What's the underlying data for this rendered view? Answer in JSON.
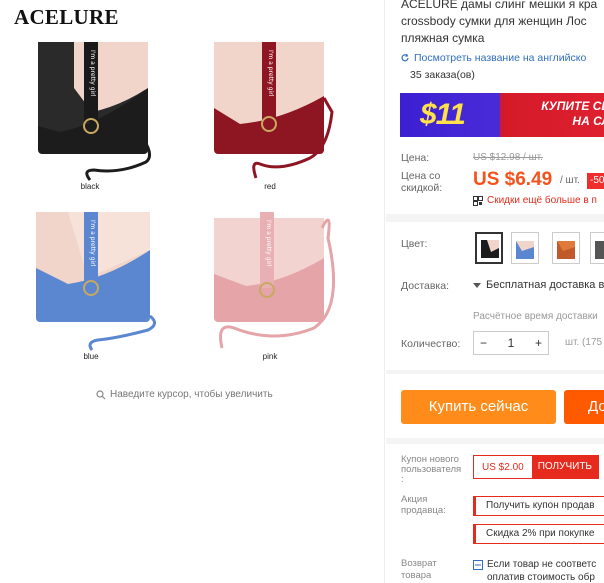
{
  "brand": "ACELURE",
  "gallery": {
    "variants": [
      {
        "caption": "black"
      },
      {
        "caption": "red"
      },
      {
        "caption": "blue"
      },
      {
        "caption": "pink"
      }
    ],
    "strap_text": "I'm a pretty girl",
    "zoom_hint": "Наведите курсор, чтобы увеличить"
  },
  "product": {
    "title_lines": [
      "ACELURE дамы слинг мешки я кра",
      "crossbody сумки для женщин Лос",
      "пляжная сумка"
    ],
    "translate_link": "Посмотреть название на английско",
    "orders": "35 заказа(ов)"
  },
  "banner": {
    "amount": "$11",
    "line1": "КУПИТЕ СЕЙ",
    "line2": "НА СЛЕ"
  },
  "price": {
    "label": "Цена:",
    "old": "US $12.98 / шт.",
    "discount_label_1": "Цена со",
    "discount_label_2": "скидкой:",
    "current": "US $6.49",
    "unit": "/ шт.",
    "badge": "-50",
    "more_discounts": "Скидки ещё больше в п"
  },
  "options": {
    "color_label": "Цвет:",
    "shipping_label": "Доставка:",
    "shipping_value": "Бесплатная доставка в R",
    "shipping_sub": "Расчётное время доставки",
    "quantity_label": "Количество:",
    "quantity_value": "1",
    "minus": "−",
    "plus": "+",
    "available": "шт. (175"
  },
  "buttons": {
    "buy": "Купить сейчас",
    "cart": "До"
  },
  "coupons": {
    "new_user_label_1": "Купон нового",
    "new_user_label_2": "пользователя",
    "new_user_label_3": ":",
    "coupon_value": "US $2.00",
    "coupon_get": "ПОЛУЧИТЬ",
    "promo_label_1": "Акция",
    "promo_label_2": "продавца:",
    "promo_1": "Получить купон продав",
    "promo_2": "Скидка 2% при покупке",
    "return_label_1": "Возврат",
    "return_label_2": "товара",
    "return_1": "Если товар не соответс",
    "return_2": "оплатив стоимость обр"
  },
  "colors": {
    "price": "#f5521c",
    "button_buy": "#ff8c1a",
    "button_cart": "#ff5a00",
    "link": "#2f6ec2",
    "badge": "#f02d2d"
  }
}
